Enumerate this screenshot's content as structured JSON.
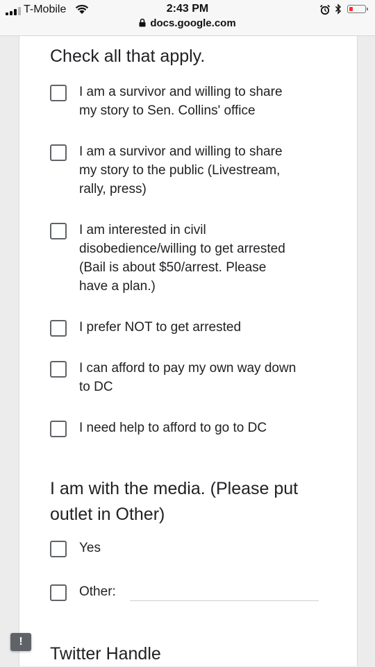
{
  "status_bar": {
    "carrier": "T-Mobile",
    "time": "2:43 PM",
    "url": "docs.google.com",
    "signal_bars": 4,
    "signal_bars_active": 3,
    "battery_level": 0.15,
    "battery_color": "#ff2d2d"
  },
  "form": {
    "questions": [
      {
        "title": "Check all that apply.",
        "options": [
          [
            "I am a survivor and willing to share",
            "my story to Sen. Collins' office"
          ],
          [
            "I am a survivor and willing to share",
            "my story to the public (Livestream,",
            "rally, press)"
          ],
          [
            "I am interested in civil",
            "disobedience/willing to get arrested",
            "(Bail is about $50/arrest. Please",
            "have a plan.)"
          ],
          [
            "I prefer NOT to get arrested"
          ],
          [
            "I can afford to pay my own way down",
            "to DC"
          ],
          [
            "I need help to afford to go to DC"
          ]
        ]
      },
      {
        "title_lines": [
          "I am with the media. (Please put",
          "outlet in Other)"
        ],
        "options": [
          [
            "Yes"
          ]
        ],
        "other_label": "Other:",
        "other_value": ""
      },
      {
        "title": "Twitter Handle"
      }
    ]
  },
  "colors": {
    "background": "#ececec",
    "card": "#ffffff",
    "checkbox_border": "#5f6368",
    "text": "#202124"
  },
  "icons": {
    "wifi": "wifi-icon",
    "lock": "lock-icon",
    "alarm": "alarm-icon",
    "bluetooth": "bluetooth-icon",
    "battery": "battery-icon",
    "report": "report-problem-icon"
  }
}
